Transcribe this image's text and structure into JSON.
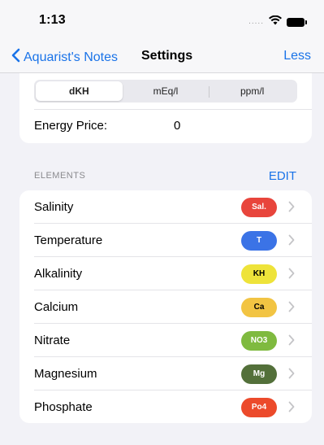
{
  "status": {
    "time": "1:13",
    "dots": "....."
  },
  "nav": {
    "back_label": "Aquarist's Notes",
    "title": "Settings",
    "right_label": "Less"
  },
  "units": {
    "options": [
      "dKH",
      "mEq/l",
      "ppm/l"
    ],
    "selected": "dKH"
  },
  "energy": {
    "label": "Energy Price:",
    "value": "0"
  },
  "elements": {
    "header": "ELEMENTS",
    "action": "EDIT",
    "items": [
      {
        "name": "Salinity",
        "badge": "Sal.",
        "badge_color": "#e8453c",
        "badge_text_color": "#ffffff"
      },
      {
        "name": "Temperature",
        "badge": "T",
        "badge_color": "#3b73e6",
        "badge_text_color": "#ffffff"
      },
      {
        "name": "Alkalinity",
        "badge": "KH",
        "badge_color": "#eee33a",
        "badge_text_color": "#000000"
      },
      {
        "name": "Calcium",
        "badge": "Ca",
        "badge_color": "#f2c443",
        "badge_text_color": "#000000"
      },
      {
        "name": "Nitrate",
        "badge": "NO3",
        "badge_color": "#7fba3f",
        "badge_text_color": "#ffffff"
      },
      {
        "name": "Magnesium",
        "badge": "Mg",
        "badge_color": "#53703a",
        "badge_text_color": "#ffffff"
      },
      {
        "name": "Phosphate",
        "badge": "Po4",
        "badge_color": "#ec4a2b",
        "badge_text_color": "#ffffff"
      }
    ]
  },
  "colors": {
    "accent": "#1a73e8",
    "background": "#f2f2f7"
  }
}
